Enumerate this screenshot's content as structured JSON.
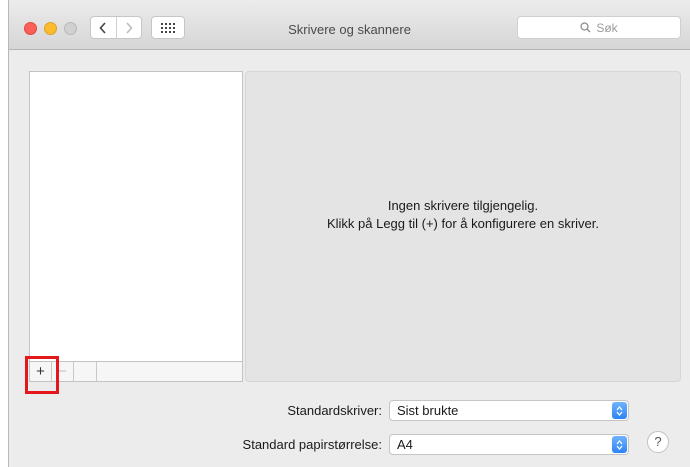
{
  "window": {
    "title": "Skrivere og skannere",
    "search_placeholder": "Søk"
  },
  "sidebar": {
    "add_label": "+",
    "remove_label": "−"
  },
  "detail": {
    "message_line1": "Ingen skrivere tilgjengelig.",
    "message_line2": "Klikk på Legg til (+) for å konfigurere en skriver."
  },
  "settings": {
    "default_printer_label": "Standardskriver:",
    "default_printer_value": "Sist brukte",
    "paper_size_label": "Standard papirstørrelse:",
    "paper_size_value": "A4"
  },
  "help_label": "?",
  "colors": {
    "highlight": "#e3181b",
    "accent": "#2c83f5"
  }
}
